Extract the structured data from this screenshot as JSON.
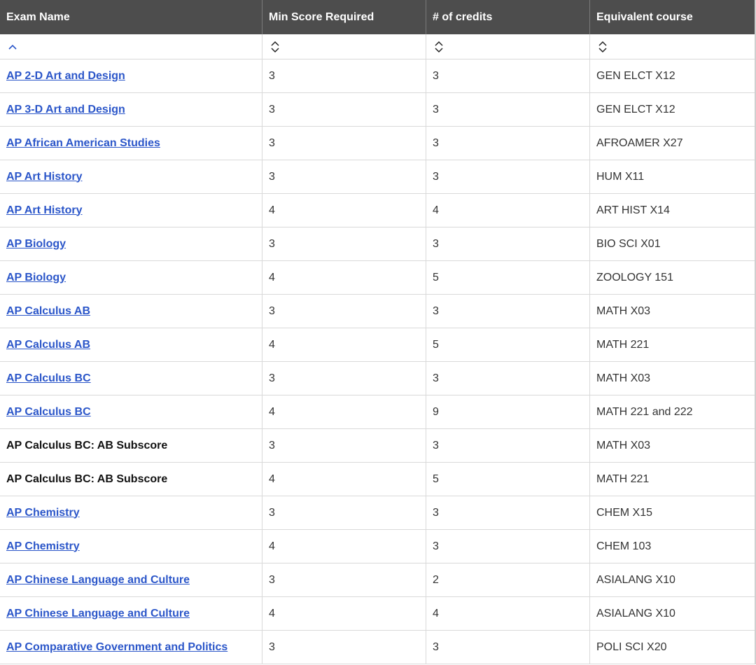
{
  "table": {
    "headers": [
      "Exam Name",
      "Min Score Required",
      "# of credits",
      "Equivalent course"
    ],
    "sort_icons": [
      "chevron-up-icon",
      "sort-updown-icon",
      "sort-updown-icon",
      "sort-updown-icon"
    ],
    "rows": [
      {
        "exam": "AP 2-D Art and Design",
        "link": true,
        "score": "3",
        "credits": "3",
        "course": "GEN ELCT X12"
      },
      {
        "exam": "AP 3-D Art and Design",
        "link": true,
        "score": "3",
        "credits": "3",
        "course": "GEN ELCT X12"
      },
      {
        "exam": "AP African American Studies",
        "link": true,
        "score": "3",
        "credits": "3",
        "course": "AFROAMER X27"
      },
      {
        "exam": "AP Art History",
        "link": true,
        "score": "3",
        "credits": "3",
        "course": "HUM X11"
      },
      {
        "exam": "AP Art History",
        "link": true,
        "score": "4",
        "credits": "4",
        "course": "ART HIST X14"
      },
      {
        "exam": "AP Biology",
        "link": true,
        "score": "3",
        "credits": "3",
        "course": "BIO SCI X01"
      },
      {
        "exam": "AP Biology",
        "link": true,
        "score": "4",
        "credits": "5",
        "course": "ZOOLOGY 151"
      },
      {
        "exam": "AP Calculus AB",
        "link": true,
        "score": "3",
        "credits": "3",
        "course": "MATH X03"
      },
      {
        "exam": "AP Calculus AB",
        "link": true,
        "score": "4",
        "credits": "5",
        "course": "MATH 221"
      },
      {
        "exam": "AP Calculus BC",
        "link": true,
        "score": "3",
        "credits": "3",
        "course": "MATH X03"
      },
      {
        "exam": "AP Calculus BC",
        "link": true,
        "score": "4",
        "credits": "9",
        "course": "MATH 221 and 222"
      },
      {
        "exam": "AP Calculus BC: AB Subscore",
        "link": false,
        "score": "3",
        "credits": "3",
        "course": "MATH X03"
      },
      {
        "exam": "AP Calculus BC: AB Subscore",
        "link": false,
        "score": "4",
        "credits": "5",
        "course": "MATH 221"
      },
      {
        "exam": "AP Chemistry",
        "link": true,
        "score": "3",
        "credits": "3",
        "course": "CHEM X15"
      },
      {
        "exam": "AP Chemistry",
        "link": true,
        "score": "4",
        "credits": "3",
        "course": "CHEM 103"
      },
      {
        "exam": "AP Chinese Language and Culture",
        "link": true,
        "score": "3",
        "credits": "2",
        "course": "ASIALANG X10"
      },
      {
        "exam": "AP Chinese Language and Culture",
        "link": true,
        "score": "4",
        "credits": "4",
        "course": "ASIALANG X10"
      },
      {
        "exam": "AP Comparative Government and Politics",
        "link": true,
        "score": "3",
        "credits": "3",
        "course": "POLI SCI X20"
      }
    ]
  },
  "colors": {
    "header_bg": "#4d4d4d",
    "link": "#2b56c9",
    "sort_active": "#2b56c9",
    "sort_inactive": "#222222"
  }
}
